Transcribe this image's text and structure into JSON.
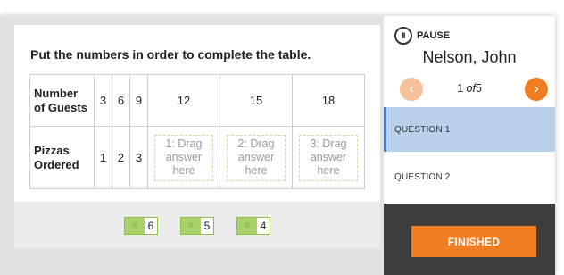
{
  "question": {
    "prompt": "Put the numbers in order to complete the table.",
    "table": {
      "row1_header": "Number of Guests",
      "row1_values": [
        "3",
        "6",
        "9",
        "12",
        "15",
        "18"
      ],
      "row2_header": "Pizzas Ordered",
      "row2_values": [
        "1",
        "2",
        "3"
      ],
      "dropzones": [
        "1: Drag answer here",
        "2: Drag answer here",
        "3: Drag answer here"
      ]
    },
    "answers": [
      "6",
      "5",
      "4"
    ]
  },
  "sidebar": {
    "pause_label": "PAUSE",
    "student_name": "Nelson, John",
    "counter_current": "1",
    "counter_of": "of",
    "counter_total": "5",
    "questions": [
      "QUESTION 1",
      "QUESTION 2"
    ],
    "finished_label": "FINISHED"
  },
  "colors": {
    "accent_orange": "#f07d22",
    "active_question_bg": "#b9d1eb",
    "answer_chip_green": "#a8d36b",
    "bottom_panel": "#3d3d3d"
  },
  "icons": {
    "pause": "pause-circle-icon",
    "prev": "chevron-left-icon",
    "next": "chevron-right-icon",
    "grip": "drag-grip-icon"
  }
}
